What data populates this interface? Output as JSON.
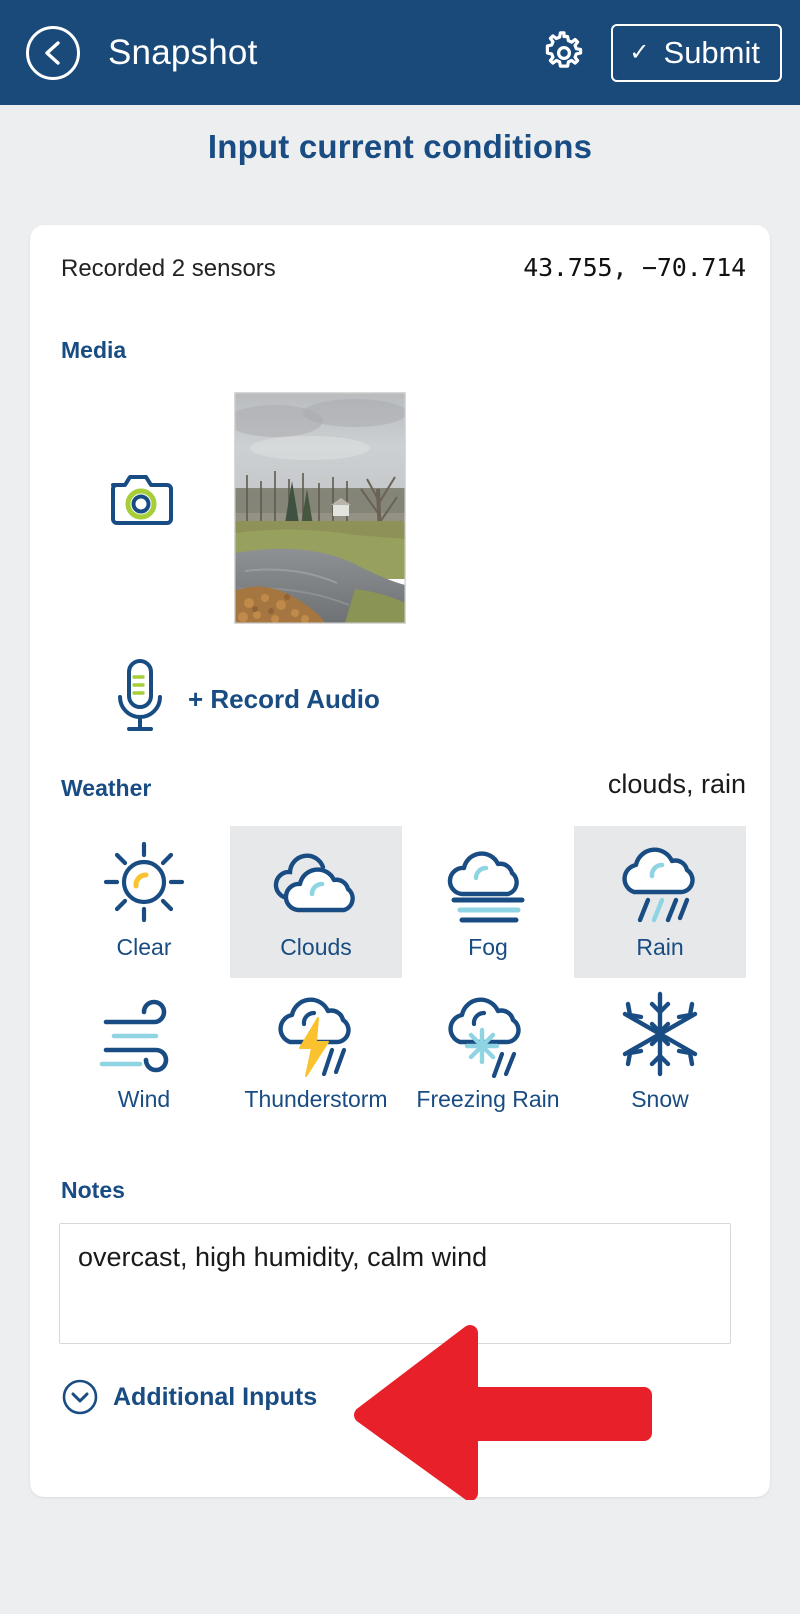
{
  "appbar": {
    "back_icon": "chevron-left-circle-icon",
    "title": "Snapshot",
    "settings_icon": "gear-icon",
    "submit_check": "✓",
    "submit_label": "Submit",
    "bg_color": "#1a4a7a"
  },
  "page": {
    "heading": "Input current conditions",
    "bg_color": "#eceef0",
    "accent_navy": "#184c82",
    "accent_green": "#a6ce39",
    "accent_lightblue": "#8ed4e3",
    "accent_yellow": "#f9c22e",
    "arrow_red": "#e8202a"
  },
  "card": {
    "recorded": "Recorded 2 sensors",
    "coordinates": "43.755, −70.714",
    "media": {
      "label": "Media",
      "camera_icon": "camera-icon",
      "photo_alt": "landscape-photo-thumbnail",
      "mic_icon": "microphone-icon",
      "record_audio_label": "+ Record Audio"
    },
    "weather": {
      "label": "Weather",
      "summary": "clouds, rain",
      "options": [
        {
          "id": "clear",
          "label": "Clear",
          "icon": "sun-icon",
          "selected": false
        },
        {
          "id": "clouds",
          "label": "Clouds",
          "icon": "clouds-icon",
          "selected": true
        },
        {
          "id": "fog",
          "label": "Fog",
          "icon": "fog-icon",
          "selected": false
        },
        {
          "id": "rain",
          "label": "Rain",
          "icon": "rain-cloud-icon",
          "selected": true
        },
        {
          "id": "wind",
          "label": "Wind",
          "icon": "wind-icon",
          "selected": false
        },
        {
          "id": "thunderstorm",
          "label": "Thunderstorm",
          "icon": "thunderstorm-icon",
          "selected": false
        },
        {
          "id": "freezing-rain",
          "label": "Freezing Rain",
          "icon": "freezing-rain-icon",
          "selected": false
        },
        {
          "id": "snow",
          "label": "Snow",
          "icon": "snowflake-icon",
          "selected": false
        }
      ]
    },
    "notes": {
      "label": "Notes",
      "value": "overcast, high humidity, calm wind",
      "placeholder": ""
    },
    "additional_inputs": {
      "label": "Additional Inputs",
      "icon": "chevron-down-circle-icon"
    }
  },
  "annotation": {
    "arrow_icon": "red-left-arrow-pointer",
    "color": "#e8202a"
  }
}
